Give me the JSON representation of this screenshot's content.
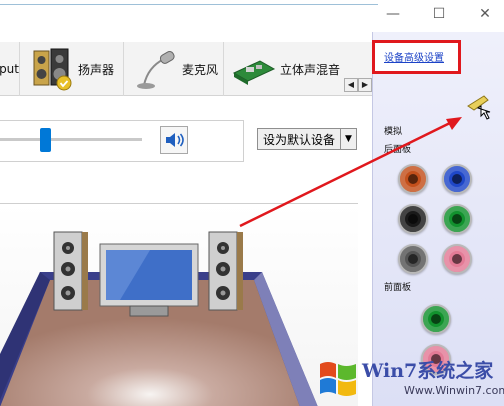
{
  "tabs": [
    {
      "label": "put",
      "icon": "playback-icon"
    },
    {
      "label": "扬声器",
      "icon": "speaker-icon"
    },
    {
      "label": "麦克风",
      "icon": "microphone-icon"
    },
    {
      "label": "立体声混音",
      "icon": "stereo-mix-icon"
    }
  ],
  "window_controls": {
    "minimize": "—",
    "maximize": "☐",
    "close": "✕"
  },
  "tab_scroll": {
    "left": "◀",
    "right": "▶"
  },
  "volume": {
    "level": 0.28,
    "default_device_label": "设为默认设备",
    "dropdown_arrow": "▼"
  },
  "right_panel": {
    "advanced_link": "设备高级设置",
    "analog_label": "模拟",
    "rear_panel_label": "后面板",
    "front_panel_label": "前面板",
    "rear_jacks": [
      "#c4501c",
      "#1f47c8",
      "#1a1a1a",
      "#12922e",
      "#555555",
      "#e37b96"
    ],
    "front_jacks": [
      "#12922e",
      "#e37b96"
    ]
  },
  "colors": {
    "accent": "#0078d7",
    "highlight_box": "#e0181d",
    "arrow": "#e0181d"
  },
  "watermark": {
    "brand": "Win7系统之家",
    "url": "Www.Winwin7.com"
  }
}
